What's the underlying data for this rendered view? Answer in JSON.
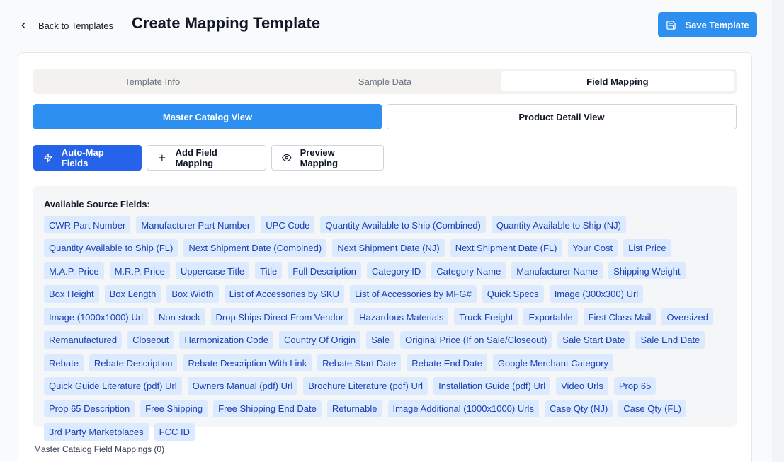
{
  "header": {
    "back_label": "Back to Templates",
    "title": "Create Mapping Template",
    "save_label": "Save Template"
  },
  "tabs": [
    {
      "label": "Template Info",
      "active": false
    },
    {
      "label": "Sample Data",
      "active": false
    },
    {
      "label": "Field Mapping",
      "active": true
    }
  ],
  "views": [
    {
      "label": "Master Catalog View",
      "active": true
    },
    {
      "label": "Product Detail View",
      "active": false
    }
  ],
  "actions": {
    "auto_map": "Auto-Map Fields",
    "add_mapping": "Add Field Mapping",
    "preview": "Preview Mapping"
  },
  "source_fields": {
    "title": "Available Source Fields:",
    "items": [
      "CWR Part Number",
      "Manufacturer Part Number",
      "UPC Code",
      "Quantity Available to Ship (Combined)",
      "Quantity Available to Ship (NJ)",
      "Quantity Available to Ship (FL)",
      "Next Shipment Date (Combined)",
      "Next Shipment Date (NJ)",
      "Next Shipment Date (FL)",
      "Your Cost",
      "List Price",
      "M.A.P. Price",
      "M.R.P. Price",
      "Uppercase Title",
      "Title",
      "Full Description",
      "Category ID",
      "Category Name",
      "Manufacturer Name",
      "Shipping Weight",
      "Box Height",
      "Box Length",
      "Box Width",
      "List of Accessories by SKU",
      "List of Accessories by MFG#",
      "Quick Specs",
      "Image (300x300) Url",
      "Image (1000x1000) Url",
      "Non-stock",
      "Drop Ships Direct From Vendor",
      "Hazardous Materials",
      "Truck Freight",
      "Exportable",
      "First Class Mail",
      "Oversized",
      "Remanufactured",
      "Closeout",
      "Harmonization Code",
      "Country Of Origin",
      "Sale",
      "Original Price (If on Sale/Closeout)",
      "Sale Start Date",
      "Sale End Date",
      "Rebate",
      "Rebate Description",
      "Rebate Description With Link",
      "Rebate Start Date",
      "Rebate End Date",
      "Google Merchant Category",
      "Quick Guide Literature (pdf) Url",
      "Owners Manual (pdf) Url",
      "Brochure Literature (pdf) Url",
      "Installation Guide (pdf) Url",
      "Video Urls",
      "Prop 65",
      "Prop 65 Description",
      "Free Shipping",
      "Free Shipping End Date",
      "Returnable",
      "Image Additional (1000x1000) Urls",
      "Case Qty (NJ)",
      "Case Qty (FL)",
      "3rd Party Marketplaces",
      "FCC ID"
    ]
  },
  "mappings": {
    "title": "Master Catalog Field Mappings (0)"
  },
  "colors": {
    "primary": "#2d8ff0",
    "auto_map": "#2563eb",
    "chip_bg": "#dbeafe",
    "chip_text": "#1e40af"
  }
}
